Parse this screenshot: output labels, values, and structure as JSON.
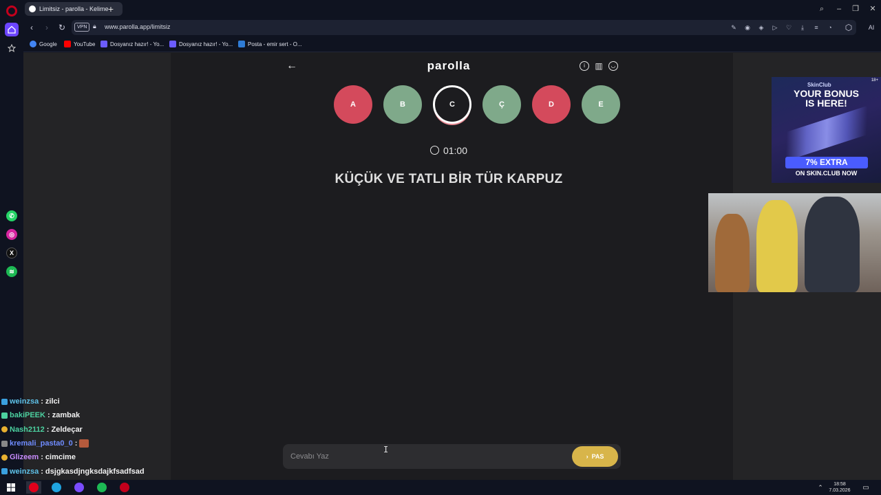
{
  "browser": {
    "tab_title": "Limitsiz - parolla - Kelime",
    "new_tab": "+",
    "url": "www.parolla.app/limitsiz",
    "vpn_label": "VPN",
    "ai_label": "AI",
    "bookmarks": [
      {
        "label": "Google",
        "color": "#4285f4"
      },
      {
        "label": "YouTube",
        "color": "#ff0000"
      },
      {
        "label": "Dosyanız hazır! - Yo...",
        "color": "#6b5cff"
      },
      {
        "label": "Dosyanız hazır! - Yo...",
        "color": "#6b5cff"
      },
      {
        "label": "Posta - emir sert - O...",
        "color": "#2f7cd6"
      }
    ]
  },
  "app": {
    "title": "parolla",
    "letters": [
      {
        "label": "A",
        "state": "wrong"
      },
      {
        "label": "B",
        "state": "correct"
      },
      {
        "label": "C",
        "state": "active"
      },
      {
        "label": "Ç",
        "state": "correct"
      },
      {
        "label": "D",
        "state": "wrong"
      },
      {
        "label": "E",
        "state": "correct"
      }
    ],
    "timer": "01:00",
    "question": "KÜÇÜK VE TATLI BİR TÜR KARPUZ",
    "answer_placeholder": "Cevabı Yaz",
    "pass_label": "PAS"
  },
  "ad": {
    "brand": "SkinClub",
    "age": "18+",
    "headline_1": "YOUR BONUS",
    "headline_2": "IS HERE!",
    "extra": "7% EXTRA",
    "site": "ON SKIN.CLUB NOW"
  },
  "chat": [
    {
      "user": "weinzsa",
      "message": "zilci",
      "color": "#5ec1e8"
    },
    {
      "user": "bakiPEEK",
      "message": "zambak",
      "color": "#4cd1a0"
    },
    {
      "user": "Nash2112",
      "message": "Zeldeçar",
      "color": "#4cd1a0"
    },
    {
      "user": "kremali_pasta0_0",
      "message": "",
      "color": "#6f8cff"
    },
    {
      "user": "Glizeem",
      "message": "cimcime",
      "color": "#c98cff"
    },
    {
      "user": "weinzsa",
      "message": "dsjgkasdjngksdajkfsadfsad",
      "color": "#5ec1e8"
    }
  ],
  "taskbar": {
    "time": "18:58",
    "date": "7.03.2026"
  },
  "colors": {
    "wrong": "#d44a5c",
    "correct": "#7fa98a",
    "pass": "#d8b54a",
    "brand": "#c3001c"
  }
}
